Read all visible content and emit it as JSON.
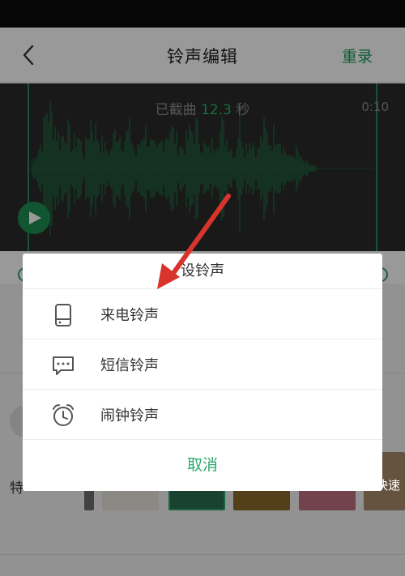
{
  "header": {
    "title": "铃声编辑",
    "rerecord_label": "重录"
  },
  "waveform": {
    "trim_prefix": "已截曲",
    "trim_seconds": "12.3",
    "trim_unit": "秒",
    "end_time": "0:10"
  },
  "lower": {
    "feature_label": "特",
    "fast_label": "快速"
  },
  "dialog": {
    "title": "设铃声",
    "options": [
      {
        "label": "来电铃声",
        "icon": "phone-icon"
      },
      {
        "label": "短信铃声",
        "icon": "message-icon"
      },
      {
        "label": "闹钟铃声",
        "icon": "alarm-clock-icon"
      }
    ],
    "cancel_label": "取消"
  },
  "colors": {
    "accent_green": "#2aa86a",
    "annotation_red": "#d9342b"
  }
}
